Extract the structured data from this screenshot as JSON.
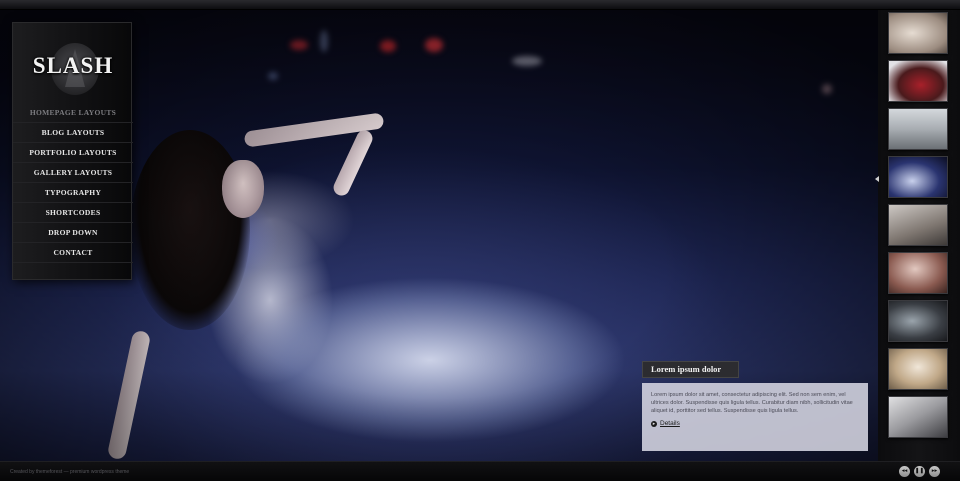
{
  "logo": {
    "text": "SLASH"
  },
  "nav": {
    "items": [
      {
        "label": "HOMEPAGE LAYOUTS",
        "active": true
      },
      {
        "label": "BLOG LAYOUTS"
      },
      {
        "label": "PORTFOLIO LAYOUTS"
      },
      {
        "label": "GALLERY LAYOUTS"
      },
      {
        "label": "TYPOGRAPHY"
      },
      {
        "label": "SHORTCODES"
      },
      {
        "label": "DROP DOWN"
      },
      {
        "label": "CONTACT"
      }
    ]
  },
  "caption": {
    "title": "Lorem ipsum dolor",
    "text": "Lorem ipsum dolor sit amet, consectetur adipiscing elit. Sed non sem enim, vel ultrices dolor. Suspendisse quis ligula tellus. Curabitur diam nibh, sollicitudin vitae aliquet id, porttitor sed tellus. Suspendisse quis ligula tellus.",
    "details_label": "Details"
  },
  "footer": {
    "credits": "Created by themeforest — premium wordpress theme"
  },
  "slideshow": {
    "controls": [
      {
        "name": "previous-slide-button",
        "glyph": "◂◂"
      },
      {
        "name": "pause-button",
        "glyph": "❚❚"
      },
      {
        "name": "next-slide-button",
        "glyph": "▸▸"
      }
    ]
  },
  "thumbnails": [
    {
      "name": "thumbnail-1"
    },
    {
      "name": "thumbnail-2"
    },
    {
      "name": "thumbnail-3"
    },
    {
      "name": "thumbnail-4",
      "active": true
    },
    {
      "name": "thumbnail-5"
    },
    {
      "name": "thumbnail-6"
    },
    {
      "name": "thumbnail-7"
    },
    {
      "name": "thumbnail-8"
    },
    {
      "name": "thumbnail-9"
    }
  ],
  "colors": {
    "panel": "#101012",
    "caption_bg": "#d6d6e2",
    "hero_blue": "#1d2552"
  }
}
